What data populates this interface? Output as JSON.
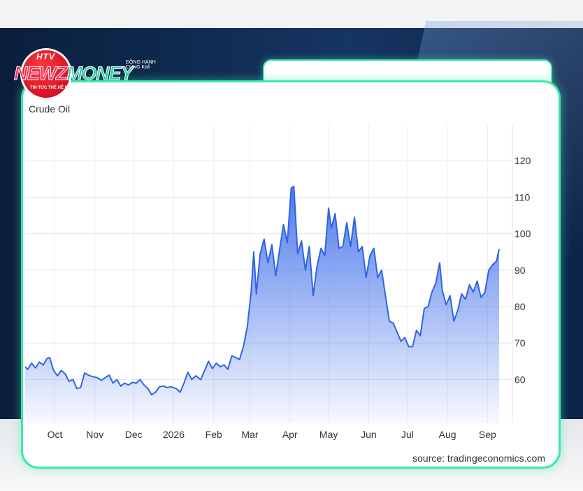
{
  "logo": {
    "badge": "HTV",
    "word_a": "NEWZ",
    "word_b": "MONEY",
    "tagline": "TIN TỨC THẾ HỆ MỚI",
    "sponsor": "ĐỒNG HÀNH CÙNG Kafi"
  },
  "colors": {
    "line": "#2f63e8",
    "fill_top": "#2f63e8",
    "accent_border": "#3ee8a6"
  },
  "source": "source: tradingeconomics.com",
  "chart_data": {
    "type": "area",
    "title": "Crude Oil",
    "xlabel": "",
    "ylabel": "",
    "ylim": [
      48,
      130
    ],
    "yticks": [
      60,
      70,
      80,
      90,
      100,
      110,
      120
    ],
    "x_start": "2025-09-08",
    "x_end": "2026-09-10",
    "xtick_labels": [
      {
        "label": "Oct",
        "date": "2025-10-01"
      },
      {
        "label": "Nov",
        "date": "2025-11-01"
      },
      {
        "label": "Dec",
        "date": "2025-12-01"
      },
      {
        "label": "2026",
        "date": "2026-01-01"
      },
      {
        "label": "Feb",
        "date": "2026-02-01"
      },
      {
        "label": "Mar",
        "date": "2026-03-01"
      },
      {
        "label": "Apr",
        "date": "2026-04-01"
      },
      {
        "label": "May",
        "date": "2026-05-01"
      },
      {
        "label": "Jun",
        "date": "2026-06-01"
      },
      {
        "label": "Jul",
        "date": "2026-07-01"
      },
      {
        "label": "Aug",
        "date": "2026-08-01"
      },
      {
        "label": "Sep",
        "date": "2026-09-01"
      }
    ],
    "grid": true,
    "series": [
      {
        "points": [
          [
            "2025-09-08",
            63.5
          ],
          [
            "2025-09-10",
            62.8
          ],
          [
            "2025-09-13",
            64.5
          ],
          [
            "2025-09-16",
            63.2
          ],
          [
            "2025-09-19",
            64.8
          ],
          [
            "2025-09-22",
            64.0
          ],
          [
            "2025-09-25",
            65.8
          ],
          [
            "2025-09-27",
            66.0
          ],
          [
            "2025-09-30",
            62.5
          ],
          [
            "2025-10-03",
            61.0
          ],
          [
            "2025-10-06",
            62.5
          ],
          [
            "2025-10-09",
            61.5
          ],
          [
            "2025-10-12",
            59.5
          ],
          [
            "2025-10-15",
            60.0
          ],
          [
            "2025-10-18",
            57.5
          ],
          [
            "2025-10-21",
            57.8
          ],
          [
            "2025-10-24",
            61.8
          ],
          [
            "2025-10-27",
            61.2
          ],
          [
            "2025-10-30",
            60.8
          ],
          [
            "2025-11-03",
            60.5
          ],
          [
            "2025-11-06",
            59.8
          ],
          [
            "2025-11-09",
            60.5
          ],
          [
            "2025-11-12",
            61.2
          ],
          [
            "2025-11-15",
            59.0
          ],
          [
            "2025-11-18",
            60.0
          ],
          [
            "2025-11-21",
            58.2
          ],
          [
            "2025-11-24",
            59.0
          ],
          [
            "2025-11-27",
            58.5
          ],
          [
            "2025-11-30",
            59.2
          ],
          [
            "2025-12-03",
            59.0
          ],
          [
            "2025-12-06",
            60.0
          ],
          [
            "2025-12-09",
            58.5
          ],
          [
            "2025-12-12",
            57.5
          ],
          [
            "2025-12-15",
            55.8
          ],
          [
            "2025-12-18",
            56.5
          ],
          [
            "2025-12-21",
            58.0
          ],
          [
            "2025-12-24",
            58.2
          ],
          [
            "2025-12-27",
            57.8
          ],
          [
            "2025-12-30",
            58.0
          ],
          [
            "2026-01-03",
            57.5
          ],
          [
            "2026-01-06",
            56.5
          ],
          [
            "2026-01-09",
            59.0
          ],
          [
            "2026-01-12",
            62.0
          ],
          [
            "2026-01-15",
            60.0
          ],
          [
            "2026-01-18",
            61.0
          ],
          [
            "2026-01-22",
            60.0
          ],
          [
            "2026-01-25",
            62.5
          ],
          [
            "2026-01-28",
            65.0
          ],
          [
            "2026-01-31",
            63.0
          ],
          [
            "2026-02-03",
            64.5
          ],
          [
            "2026-02-06",
            63.5
          ],
          [
            "2026-02-09",
            64.0
          ],
          [
            "2026-02-12",
            62.8
          ],
          [
            "2026-02-15",
            66.5
          ],
          [
            "2026-02-18",
            66.0
          ],
          [
            "2026-02-21",
            65.5
          ],
          [
            "2026-02-24",
            69.0
          ],
          [
            "2026-02-27",
            74.5
          ],
          [
            "2026-03-02",
            84.0
          ],
          [
            "2026-03-04",
            95.0
          ],
          [
            "2026-03-06",
            83.5
          ],
          [
            "2026-03-09",
            94.5
          ],
          [
            "2026-03-12",
            98.5
          ],
          [
            "2026-03-15",
            92.0
          ],
          [
            "2026-03-18",
            97.0
          ],
          [
            "2026-03-21",
            88.5
          ],
          [
            "2026-03-24",
            95.5
          ],
          [
            "2026-03-27",
            102.5
          ],
          [
            "2026-03-30",
            97.5
          ],
          [
            "2026-04-02",
            112.5
          ],
          [
            "2026-04-04",
            113.0
          ],
          [
            "2026-04-07",
            94.5
          ],
          [
            "2026-04-10",
            98.0
          ],
          [
            "2026-04-13",
            90.0
          ],
          [
            "2026-04-16",
            96.5
          ],
          [
            "2026-04-19",
            83.0
          ],
          [
            "2026-04-22",
            91.0
          ],
          [
            "2026-04-25",
            96.0
          ],
          [
            "2026-04-28",
            94.0
          ],
          [
            "2026-05-01",
            107.0
          ],
          [
            "2026-05-03",
            101.5
          ],
          [
            "2026-05-06",
            105.5
          ],
          [
            "2026-05-09",
            96.0
          ],
          [
            "2026-05-12",
            96.5
          ],
          [
            "2026-05-15",
            103.0
          ],
          [
            "2026-05-18",
            96.5
          ],
          [
            "2026-05-21",
            104.5
          ],
          [
            "2026-05-24",
            95.0
          ],
          [
            "2026-05-27",
            96.5
          ],
          [
            "2026-05-30",
            88.0
          ],
          [
            "2026-06-02",
            94.0
          ],
          [
            "2026-06-05",
            96.0
          ],
          [
            "2026-06-08",
            88.0
          ],
          [
            "2026-06-11",
            90.0
          ],
          [
            "2026-06-14",
            83.0
          ],
          [
            "2026-06-17",
            76.0
          ],
          [
            "2026-06-20",
            75.5
          ],
          [
            "2026-06-23",
            73.0
          ],
          [
            "2026-06-26",
            70.5
          ],
          [
            "2026-06-29",
            71.5
          ],
          [
            "2026-07-02",
            69.0
          ],
          [
            "2026-07-05",
            69.0
          ],
          [
            "2026-07-08",
            73.5
          ],
          [
            "2026-07-11",
            72.0
          ],
          [
            "2026-07-14",
            79.5
          ],
          [
            "2026-07-17",
            80.0
          ],
          [
            "2026-07-20",
            84.0
          ],
          [
            "2026-07-23",
            86.5
          ],
          [
            "2026-07-26",
            92.0
          ],
          [
            "2026-07-28",
            84.5
          ],
          [
            "2026-07-31",
            80.5
          ],
          [
            "2026-08-03",
            83.0
          ],
          [
            "2026-08-06",
            76.0
          ],
          [
            "2026-08-09",
            79.0
          ],
          [
            "2026-08-12",
            83.5
          ],
          [
            "2026-08-15",
            82.0
          ],
          [
            "2026-08-18",
            86.0
          ],
          [
            "2026-08-21",
            84.0
          ],
          [
            "2026-08-24",
            87.0
          ],
          [
            "2026-08-27",
            82.5
          ],
          [
            "2026-08-30",
            84.0
          ],
          [
            "2026-09-02",
            90.0
          ],
          [
            "2026-09-05",
            91.5
          ],
          [
            "2026-09-08",
            92.5
          ],
          [
            "2026-09-10",
            95.8
          ]
        ]
      }
    ]
  }
}
